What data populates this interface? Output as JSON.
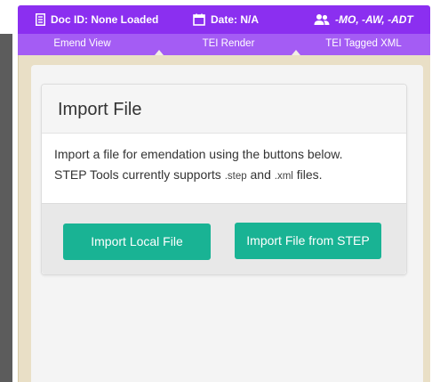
{
  "header": {
    "doc_id": "Doc ID: None Loaded",
    "date": "Date: N/A",
    "users": "-MO, -AW, -ADT",
    "doc_icon": "document-icon",
    "date_icon": "calendar-icon",
    "users_icon": "users-icon"
  },
  "tabs": [
    {
      "label": "Emend View"
    },
    {
      "label": "TEI Render"
    },
    {
      "label": "TEI Tagged XML"
    }
  ],
  "panel": {
    "title": "Import File",
    "body_line1": "Import a file for emendation using the buttons below.",
    "body_line2_a": "STEP Tools currently supports ",
    "ext_step": ".step",
    "and": " and ",
    "ext_xml": ".xml",
    "body_line2_b": " files."
  },
  "buttons": {
    "import_local": "Import Local File",
    "import_step": "Import File from STEP"
  },
  "colors": {
    "header_bg": "#8b2ff0",
    "tabs_bg": "#a45cf4",
    "button_bg": "#19b394",
    "frame_bg": "#e9dfc6"
  }
}
